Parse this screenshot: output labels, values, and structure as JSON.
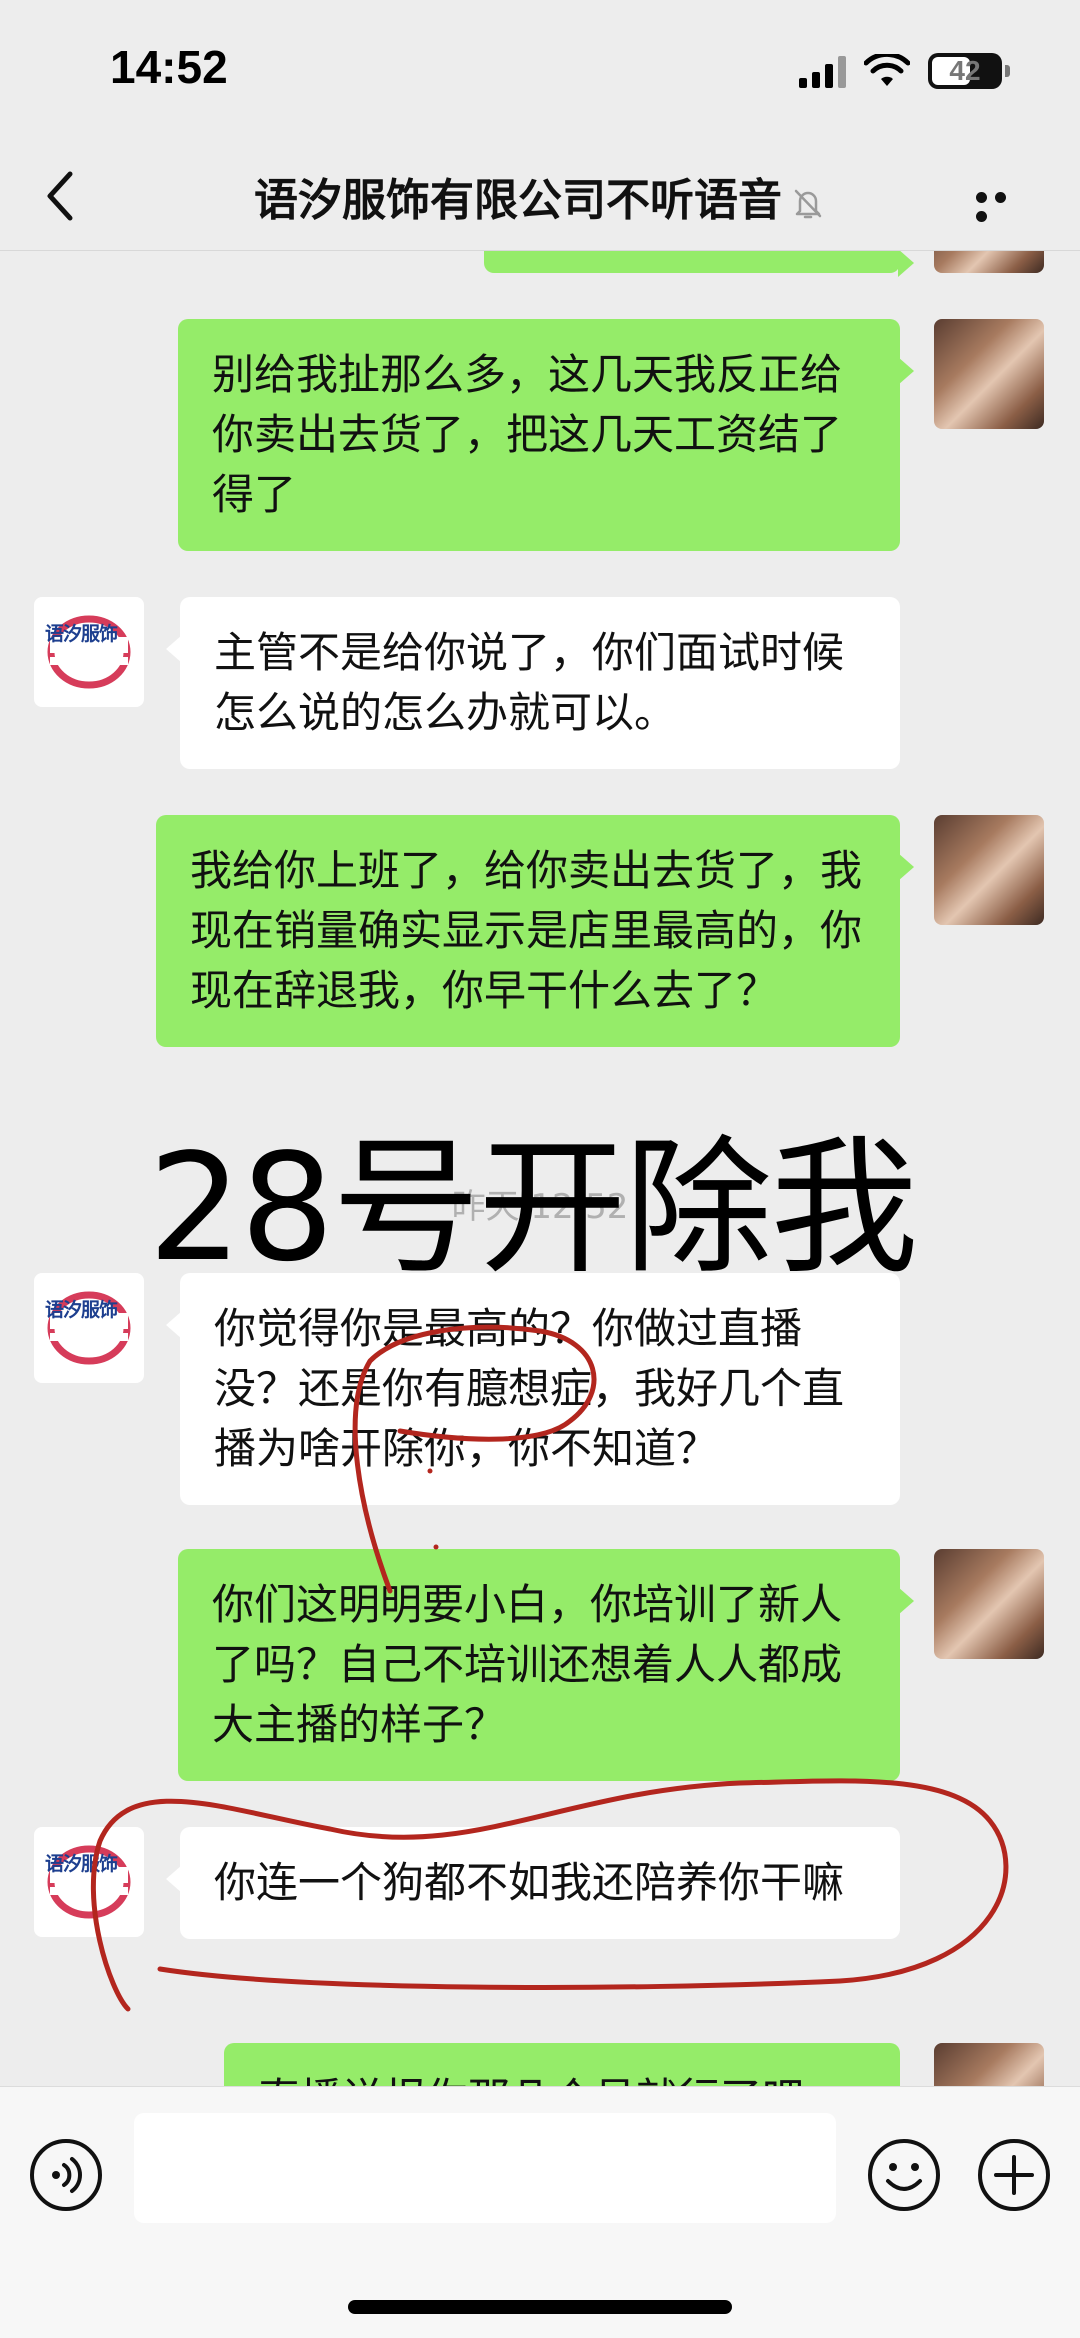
{
  "status_bar": {
    "time": "14:52",
    "battery_level": "42"
  },
  "header": {
    "title": "语汐服饰有限公司不听语音"
  },
  "company_logo_text": "语汐服饰",
  "messages": [
    {
      "sender": "me",
      "text": "别给我扯那么多，这几天我反正给你卖出去货了，把这几天工资结了得了"
    },
    {
      "sender": "them",
      "text": "主管不是给你说了，你们面试时候怎么说的怎么办就可以。"
    },
    {
      "sender": "me",
      "text": "我给你上班了，给你卖出去货了，我现在销量确实显示是店里最高的，你现在辞退我，你早干什么去了？"
    },
    {
      "sender": "them",
      "text": "你觉得你是最高的？你做过直播没？还是你有臆想症，我好几个直播为啥开除你，你不知道？"
    },
    {
      "sender": "me",
      "text": "你们这明明要小白，你培训了新人了吗？自己不培训还想着人人都成大主播的样子？"
    },
    {
      "sender": "them",
      "text": "你连一个狗都不如我还陪养你干嘛"
    },
    {
      "sender": "me",
      "text": "直播说报你那几个号就行了吧"
    }
  ],
  "timestamp": "昨天 12:52",
  "overlay_caption": "28号开除我",
  "colors": {
    "background": "#ededed",
    "my_bubble": "#95ec69",
    "their_bubble": "#ffffff",
    "annotation": "#b3261e"
  },
  "icons": {
    "back": "chevron-left-icon",
    "mute": "bell-slash-icon",
    "more": "ellipsis-icon",
    "voice": "voice-icon",
    "emoji": "emoji-icon",
    "plus": "plus-icon"
  }
}
